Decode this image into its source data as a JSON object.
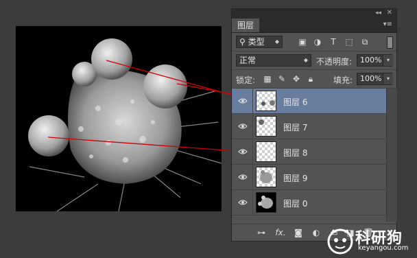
{
  "panel": {
    "tab_label": "图层",
    "filter_kind": "类型",
    "blend_mode": "正常",
    "opacity_label": "不透明度:",
    "opacity_value": "100%",
    "lock_label": "锁定:",
    "fill_label": "填充:",
    "fill_value": "100%"
  },
  "layers": [
    {
      "name": "图层 6",
      "selected": true
    },
    {
      "name": "图层 7",
      "selected": false
    },
    {
      "name": "图层 8",
      "selected": false
    },
    {
      "name": "图层 9",
      "selected": false
    },
    {
      "name": "图层 0",
      "selected": false
    }
  ],
  "footer": {
    "fx_label": "fx."
  },
  "watermark": {
    "brand": "科研狗",
    "url": "keyangou.com"
  },
  "colors": {
    "panel_bg": "#535353",
    "selected_layer": "#687d9e",
    "arrow": "#d40000"
  }
}
